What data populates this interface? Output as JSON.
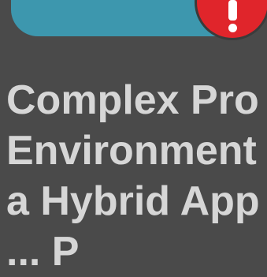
{
  "icons": {
    "gear": "gear-icon",
    "alert": "exclamation-alert-icon"
  },
  "colors": {
    "background": "#4a4a4a",
    "banner": "#3d97ae",
    "alert": "#e0252b",
    "text": "#d6d6d6"
  },
  "headline": {
    "lines": [
      "Complex Pro",
      "Environment",
      "a Hybrid App",
      "... P"
    ]
  }
}
